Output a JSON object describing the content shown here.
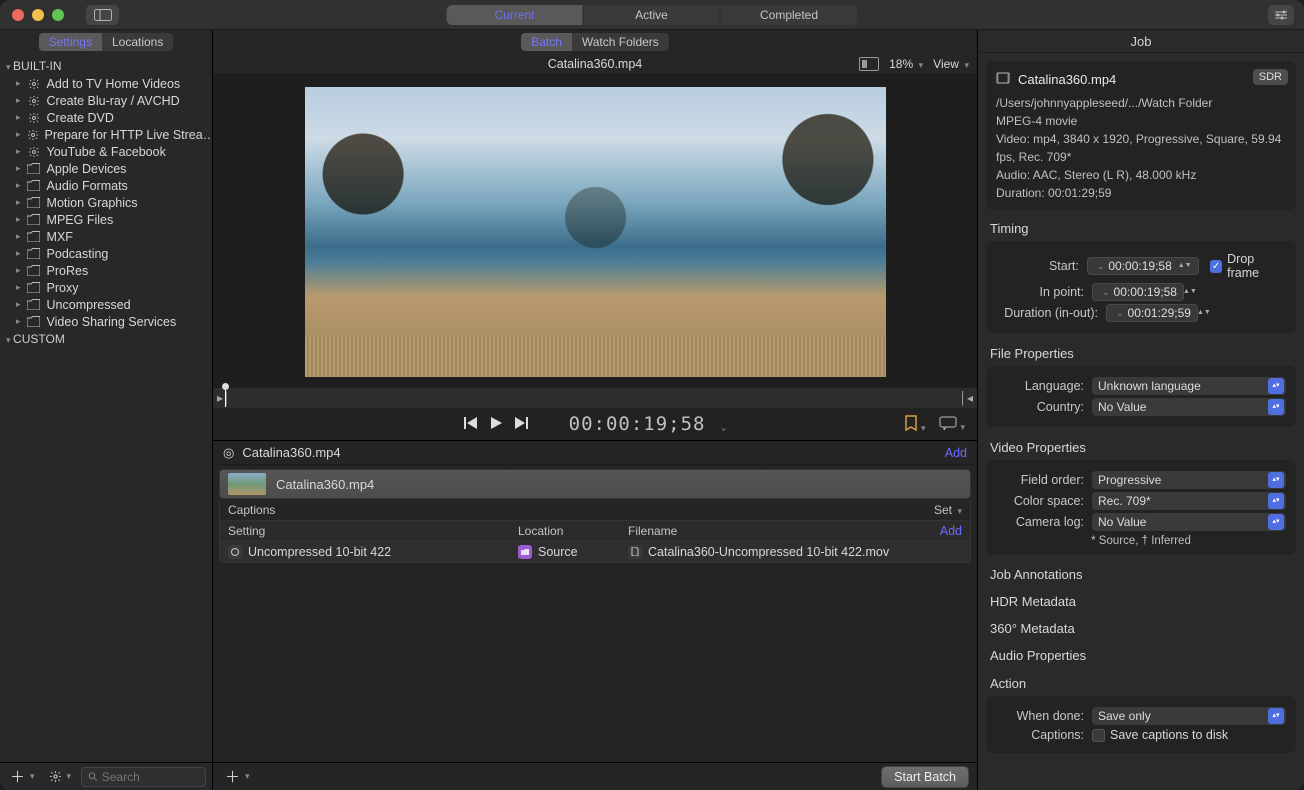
{
  "titlebar": {
    "segments": [
      "Current",
      "Active",
      "Completed"
    ],
    "active": 0
  },
  "left": {
    "tabs": [
      "Settings",
      "Locations"
    ],
    "active": 0,
    "groups": [
      {
        "label": "BUILT-IN",
        "items": [
          {
            "label": "Add to TV Home Videos",
            "gear": true
          },
          {
            "label": "Create Blu-ray / AVCHD",
            "gear": true
          },
          {
            "label": "Create DVD",
            "gear": true
          },
          {
            "label": "Prepare for HTTP Live Strea…",
            "gear": true
          },
          {
            "label": "YouTube & Facebook",
            "gear": true
          },
          {
            "label": "Apple Devices",
            "gear": false
          },
          {
            "label": "Audio Formats",
            "gear": false
          },
          {
            "label": "Motion Graphics",
            "gear": false
          },
          {
            "label": "MPEG Files",
            "gear": false
          },
          {
            "label": "MXF",
            "gear": false
          },
          {
            "label": "Podcasting",
            "gear": false
          },
          {
            "label": "ProRes",
            "gear": false
          },
          {
            "label": "Proxy",
            "gear": false
          },
          {
            "label": "Uncompressed",
            "gear": false
          },
          {
            "label": "Video Sharing Services",
            "gear": false
          }
        ]
      },
      {
        "label": "CUSTOM",
        "items": []
      }
    ],
    "search_placeholder": "Search"
  },
  "center": {
    "tabs": [
      "Batch",
      "Watch Folders"
    ],
    "active": 0,
    "file": "Catalina360.mp4",
    "zoom": "18%",
    "view_label": "View",
    "timecode": "00:00:19;58",
    "batch": {
      "job_title": "Catalina360.mp4",
      "add": "Add",
      "clip": "Catalina360.mp4",
      "captions": "Captions",
      "set": "Set",
      "cols": {
        "setting": "Setting",
        "location": "Location",
        "filename": "Filename",
        "add": "Add"
      },
      "row": {
        "setting": "Uncompressed 10-bit 422",
        "location": "Source",
        "filename": "Catalina360-Uncompressed 10-bit 422.mov"
      }
    },
    "start": "Start Batch"
  },
  "right": {
    "header": "Job",
    "job": {
      "title": "Catalina360.mp4",
      "badge": "SDR",
      "path": "/Users/johnnyappleseed/.../Watch Folder",
      "kind": "MPEG-4 movie",
      "video": "Video: mp4, 3840 x 1920, Progressive, Square, 59.94 fps, Rec. 709*",
      "audio": "Audio: AAC, Stereo (L R), 48.000 kHz",
      "duration": "Duration: 00:01:29;59"
    },
    "sections": {
      "timing": "Timing",
      "fileprops": "File Properties",
      "vidprops": "Video Properties",
      "job_ann": "Job Annotations",
      "hdr": "HDR Metadata",
      "s360": "360° Metadata",
      "aud": "Audio Properties",
      "action": "Action"
    },
    "timing": {
      "start_l": "Start:",
      "start_v": "00:00:19;58",
      "in_l": "In point:",
      "in_v": "00:00:19;58",
      "dur_l": "Duration (in-out):",
      "dur_v": "00:01:29;59",
      "drop": "Drop frame"
    },
    "fileprops": {
      "lang_l": "Language:",
      "lang_v": "Unknown language",
      "country_l": "Country:",
      "country_v": "No Value"
    },
    "vidprops": {
      "field_l": "Field order:",
      "field_v": "Progressive",
      "cspace_l": "Color space:",
      "cspace_v": "Rec. 709*",
      "clog_l": "Camera log:",
      "clog_v": "No Value",
      "note": "* Source, † Inferred"
    },
    "action": {
      "when_l": "When done:",
      "when_v": "Save only",
      "cap_l": "Captions:",
      "cap_v": "Save captions to disk"
    }
  }
}
